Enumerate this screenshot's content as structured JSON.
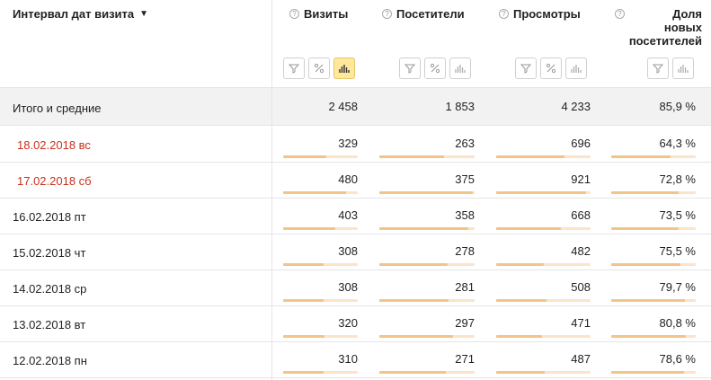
{
  "header": {
    "dimension_label": "Интервал дат визита",
    "dimension_caret": "▼",
    "help_glyph": "?",
    "metrics": [
      {
        "label": "Визиты",
        "active_icon": "bar-chart-icon"
      },
      {
        "label": "Посетители"
      },
      {
        "label": "Просмотры"
      },
      {
        "label_lines": [
          "Доля",
          "новых",
          "посетителей"
        ]
      }
    ]
  },
  "totals": {
    "label": "Итого и средние",
    "values": [
      "2 458",
      "1 853",
      "4 233",
      "85,9 %"
    ]
  },
  "rows": [
    {
      "date": "18.02.2018 вс",
      "weekend": true,
      "values": [
        "329",
        "263",
        "696",
        "64,3 %"
      ],
      "fill": [
        0.58,
        0.68,
        0.72,
        0.7
      ]
    },
    {
      "date": "17.02.2018 сб",
      "weekend": true,
      "values": [
        "480",
        "375",
        "921",
        "72,8 %"
      ],
      "fill": [
        0.84,
        0.98,
        0.95,
        0.8
      ]
    },
    {
      "date": "16.02.2018 пт",
      "weekend": false,
      "values": [
        "403",
        "358",
        "668",
        "73,5 %"
      ],
      "fill": [
        0.7,
        0.93,
        0.69,
        0.8
      ]
    },
    {
      "date": "15.02.2018 чт",
      "weekend": false,
      "values": [
        "308",
        "278",
        "482",
        "75,5 %"
      ],
      "fill": [
        0.54,
        0.72,
        0.5,
        0.82
      ]
    },
    {
      "date": "14.02.2018 ср",
      "weekend": false,
      "values": [
        "308",
        "281",
        "508",
        "79,7 %"
      ],
      "fill": [
        0.54,
        0.73,
        0.53,
        0.87
      ]
    },
    {
      "date": "13.02.2018 вт",
      "weekend": false,
      "values": [
        "320",
        "297",
        "471",
        "80,8 %"
      ],
      "fill": [
        0.56,
        0.77,
        0.49,
        0.88
      ]
    },
    {
      "date": "12.02.2018 пн",
      "weekend": false,
      "values": [
        "310",
        "271",
        "487",
        "78,6 %"
      ],
      "fill": [
        0.54,
        0.7,
        0.51,
        0.86
      ]
    }
  ],
  "colors": {
    "weekend_text": "#c8311e",
    "bar_fill": "#f4c388",
    "bar_track": "#fbe4c9",
    "active_button": "#ffe89c",
    "totals_bg": "#f2f2f2"
  }
}
